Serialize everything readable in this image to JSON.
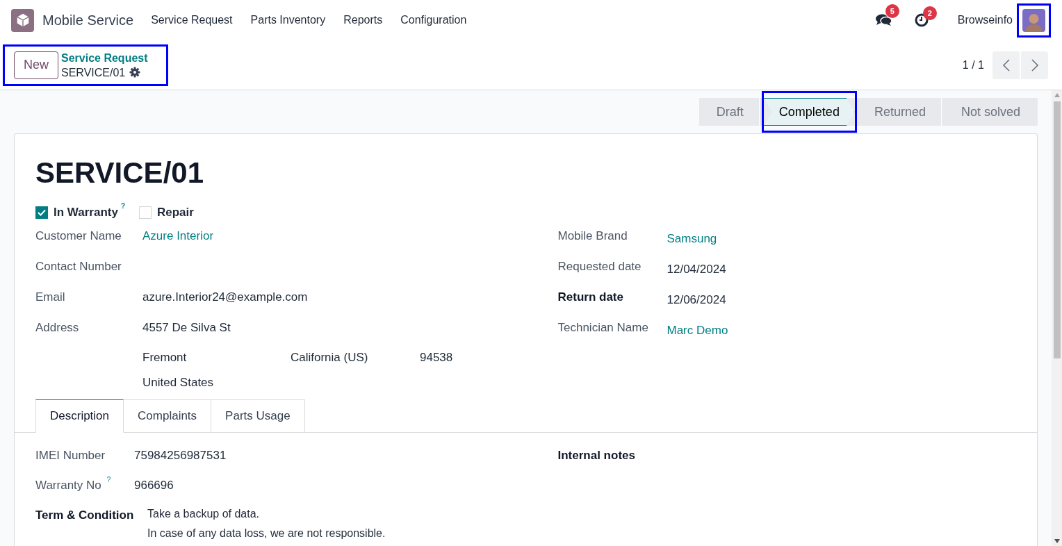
{
  "navbar": {
    "app_name": "Mobile Service",
    "menu": [
      "Service Request",
      "Parts Inventory",
      "Reports",
      "Configuration"
    ],
    "messages_badge": "5",
    "activities_badge": "2",
    "user_name": "Browseinfo",
    "avatar_highlighted": true
  },
  "control_bar": {
    "new_button": "New",
    "breadcrumb": "Service Request",
    "record": "SERVICE/01",
    "highlighted": true,
    "pager": "1 / 1"
  },
  "stages": [
    {
      "label": "Draft",
      "selected": false,
      "highlighted": false
    },
    {
      "label": "Completed",
      "selected": true,
      "highlighted": true
    },
    {
      "label": "Returned",
      "selected": false,
      "highlighted": false
    },
    {
      "label": "Not solved",
      "selected": false,
      "highlighted": false
    }
  ],
  "form": {
    "title": "SERVICE/01",
    "checkboxes": [
      {
        "label": "In Warranty",
        "checked": true,
        "help": "?"
      },
      {
        "label": "Repair",
        "checked": false
      }
    ],
    "left_fields": [
      {
        "label": "Customer Name",
        "kind": "link",
        "value": "Azure Interior"
      },
      {
        "label": "Contact Number",
        "kind": "text"
      },
      {
        "label": "Email",
        "kind": "text",
        "value": "azure.Interior24@example.com"
      },
      {
        "label": "Address",
        "kind": "address",
        "street": "4557 De Silva St",
        "city": "Fremont",
        "state": "California (US)",
        "zip": "94538",
        "country": "United States"
      }
    ],
    "right_fields": [
      {
        "label": "Mobile Brand",
        "kind": "link",
        "value": "Samsung"
      },
      {
        "label": "Requested date",
        "kind": "text",
        "value": "12/04/2024"
      },
      {
        "label": "Return date",
        "kind": "text",
        "value": "12/06/2024",
        "bold": true
      },
      {
        "label": "Technician Name",
        "kind": "link",
        "value": "Marc Demo"
      }
    ],
    "tabs": [
      {
        "label": "Description",
        "selected": true
      },
      {
        "label": "Complaints",
        "selected": false
      },
      {
        "label": "Parts Usage",
        "selected": false
      }
    ],
    "description_fields": [
      {
        "label": "IMEI Number",
        "value": "75984256987531"
      },
      {
        "label": "Warranty No",
        "value": "966696",
        "help": "?"
      },
      {
        "label": "Term & Condition",
        "bold": true,
        "lines": [
          "Take a backup of data.",
          "In case of any data loss, we are not responsible."
        ]
      }
    ],
    "internal_notes_label": "Internal notes"
  }
}
